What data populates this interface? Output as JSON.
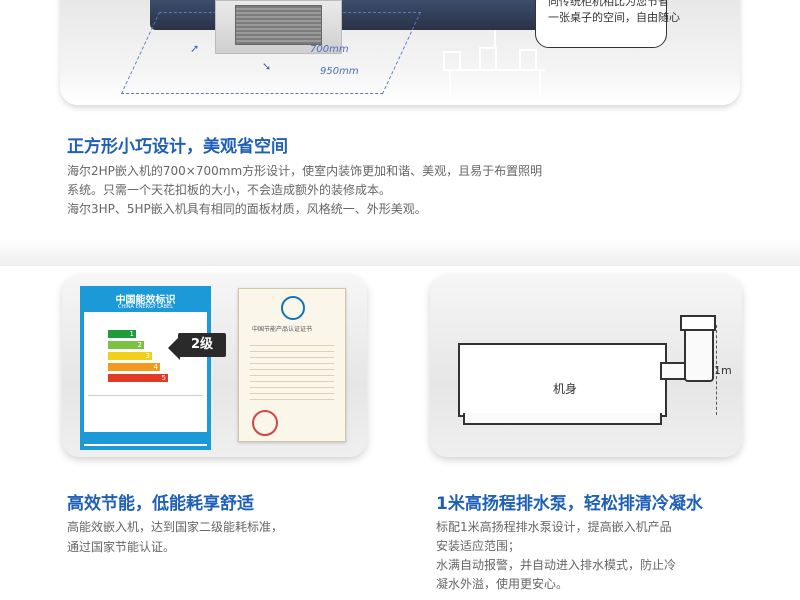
{
  "top_product": {
    "dim_outer": "950mm",
    "dim_inner": "700mm",
    "bubble_lines": [
      "同传统柜机相比为您节省",
      "一张桌子的空间，自由随心"
    ]
  },
  "section1": {
    "heading": "正方形小巧设计，美观省空间",
    "lines": [
      "海尔2HP嵌入机的700×700mm方形设计，使室内装饰更加和谐、美观，且易于布置照明",
      "系统。只需一个天花扣板的大小，不会造成额外的装修成本。",
      "海尔3HP、5HP嵌入机具有相同的面板材质，风格统一、外形美观。"
    ]
  },
  "energy_panel": {
    "label_title": "中国能效标识",
    "label_subtitle": "CHINA ENERGY LABEL",
    "grade_text": "2级",
    "bar_numbers": [
      "1",
      "2",
      "3",
      "4",
      "5"
    ],
    "bar_colors": [
      "#1f9b3a",
      "#7cc242",
      "#f2d018",
      "#f39a1e",
      "#e23a26"
    ],
    "cert_title": "中国节能产品认证证书",
    "heading": "高效节能，低能耗享舒适",
    "lines": [
      "高能效嵌入机，达到国家二级能耗标准，",
      "通过国家节能认证。"
    ]
  },
  "pump_panel": {
    "machine_label": "机身",
    "measure_label": "1m",
    "heading": "1米高扬程排水泵，轻松排清冷凝水",
    "lines": [
      "标配1米高扬程排水泵设计，提高嵌入机产品",
      "安装适应范围；",
      "水满自动报警，并自动进入排水模式，防止冷",
      "凝水外溢，使用更安心。"
    ]
  },
  "colors": {
    "heading_blue": "#1e5fb8",
    "label_blue": "#1c9ad8"
  }
}
